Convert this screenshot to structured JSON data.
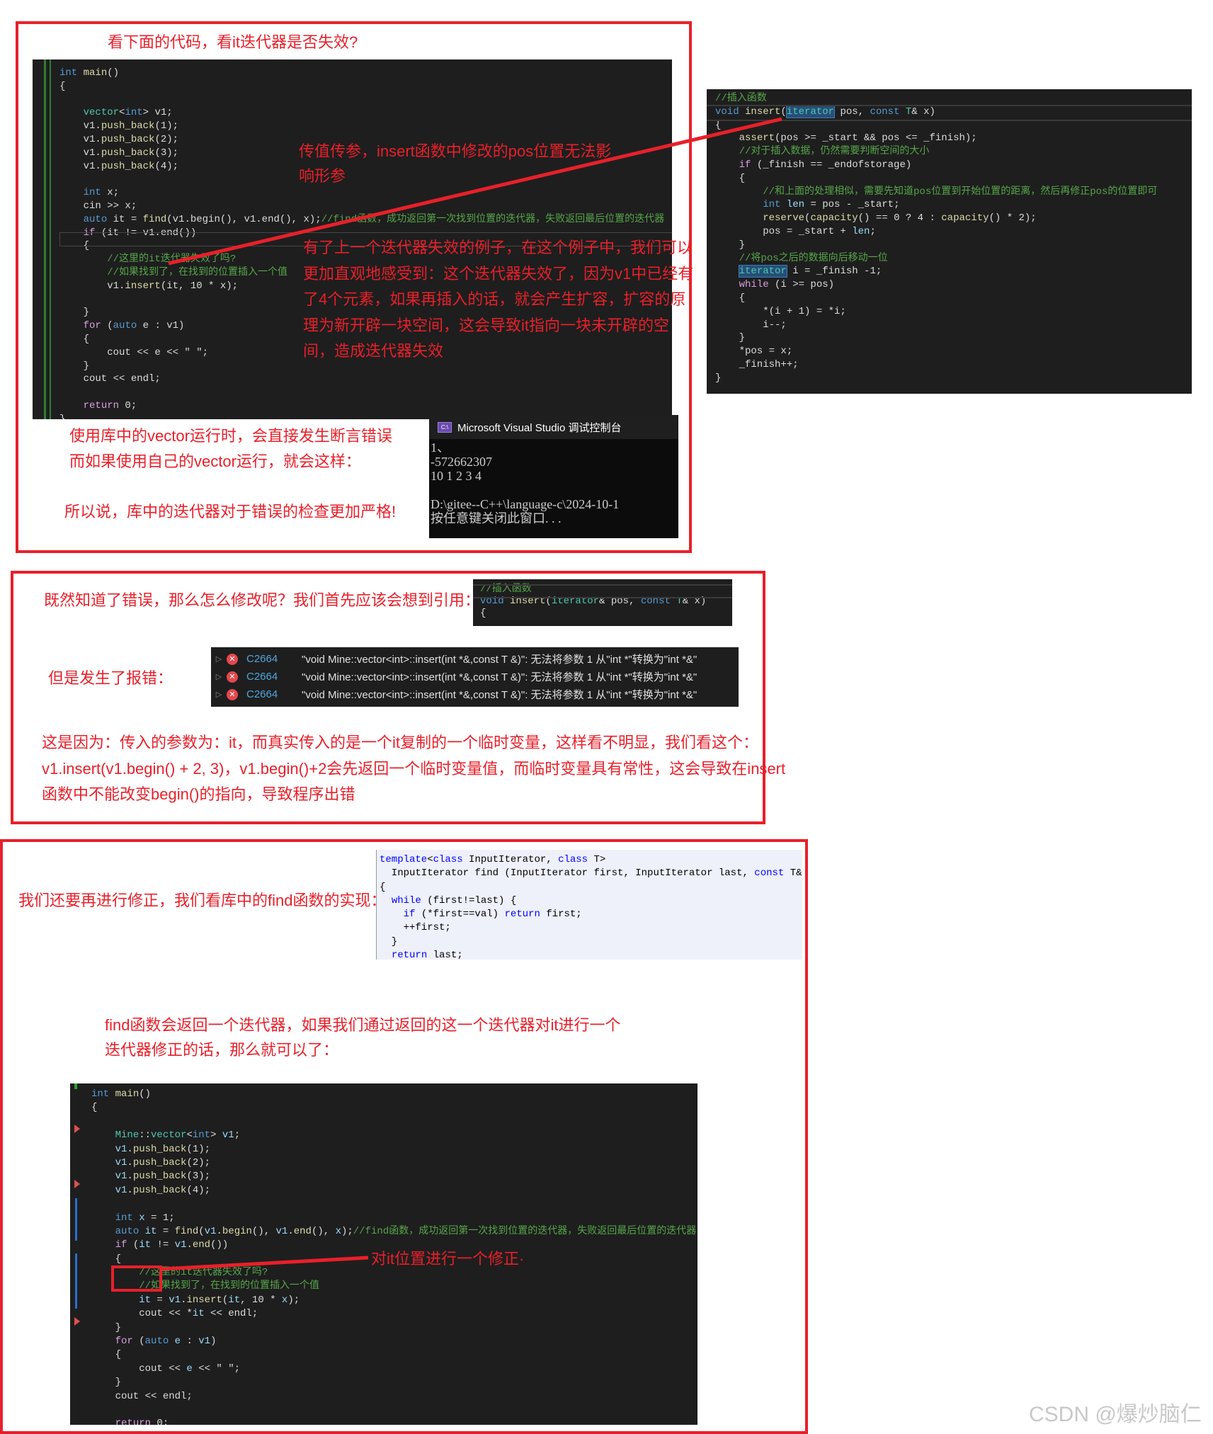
{
  "section1": {
    "title": "看下面的代码，看it迭代器是否失效?",
    "annotation_a": [
      "传值传参，insert函数中修改的pos位置无法影",
      "响形参"
    ],
    "annotation_b": [
      "有了上一个迭代器失效的例子，在这个例子中，我们可以",
      "更加直观地感受到：这个迭代器失效了，因为v1中已经有",
      "了4个元素，如果再插入的话，就会产生扩容，扩容的原",
      "理为新开辟一块空间，这会导致it指向一块未开辟的空",
      "间，造成迭代器失效"
    ],
    "notes": [
      "使用库中的vector运行时，会直接发生断言错误",
      "而如果使用自己的vector运行，就会这样：",
      "所以说，库中的迭代器对于错误的检查更加严格!"
    ],
    "console": {
      "icon_label": "C:\\",
      "title": "Microsoft Visual Studio 调试控制台",
      "output": [
        "1、",
        "-572662307",
        "10 1 2 3 4",
        "",
        "D:\\gitee--C++\\language-c\\2024-10-1",
        "按任意键关闭此窗口. . ."
      ]
    },
    "code_main": [
      [
        [
          "k",
          "int"
        ],
        [
          "f",
          " main"
        ],
        [
          "p",
          "()"
        ]
      ],
      [
        [
          "p",
          "{"
        ]
      ],
      [],
      [
        [
          "p",
          "    "
        ],
        [
          "t",
          "vector"
        ],
        [
          "p",
          "<"
        ],
        [
          "k",
          "int"
        ],
        [
          "p",
          "> v1;"
        ]
      ],
      [
        [
          "p",
          "    v1."
        ],
        [
          "f",
          "push_back"
        ],
        [
          "p",
          "(1);"
        ]
      ],
      [
        [
          "p",
          "    v1."
        ],
        [
          "f",
          "push_back"
        ],
        [
          "p",
          "(2);"
        ]
      ],
      [
        [
          "p",
          "    v1."
        ],
        [
          "f",
          "push_back"
        ],
        [
          "p",
          "(3);"
        ]
      ],
      [
        [
          "p",
          "    v1."
        ],
        [
          "f",
          "push_back"
        ],
        [
          "p",
          "(4);"
        ]
      ],
      [],
      [
        [
          "p",
          "    "
        ],
        [
          "k",
          "int"
        ],
        [
          "p",
          " x;"
        ]
      ],
      [
        [
          "p",
          "    cin >> x;"
        ]
      ],
      [
        [
          "p",
          "    "
        ],
        [
          "k",
          "auto"
        ],
        [
          "p",
          " it = "
        ],
        [
          "f",
          "find"
        ],
        [
          "p",
          "(v1.begin(), v1.end(), x);"
        ],
        [
          "c",
          "//find函数，成功返回第一次找到位置的迭代器，失败返回最后位置的迭代器"
        ]
      ],
      [
        [
          "p",
          "    "
        ],
        [
          "m",
          "if"
        ],
        [
          "p",
          " (it != v1.end())"
        ]
      ],
      [
        [
          "p",
          "    {"
        ]
      ],
      [
        [
          "p",
          "        "
        ],
        [
          "c",
          "//这里的it迭代器失效了吗?"
        ]
      ],
      [
        [
          "p",
          "        "
        ],
        [
          "c",
          "//如果找到了，在找到的位置插入一个值"
        ]
      ],
      [
        [
          "p",
          "        v1."
        ],
        [
          "f",
          "insert"
        ],
        [
          "p",
          "(it, 10 * x);"
        ]
      ],
      [],
      [
        [
          "p",
          "    }"
        ]
      ],
      [
        [
          "p",
          "    "
        ],
        [
          "m",
          "for"
        ],
        [
          "p",
          " ("
        ],
        [
          "k",
          "auto"
        ],
        [
          "p",
          " e : v1)"
        ]
      ],
      [
        [
          "p",
          "    {"
        ]
      ],
      [
        [
          "p",
          "        cout << e << \" \";"
        ]
      ],
      [
        [
          "p",
          "    }"
        ]
      ],
      [
        [
          "p",
          "    cout << endl;"
        ]
      ],
      [],
      [
        [
          "p",
          "    "
        ],
        [
          "m",
          "return"
        ],
        [
          "p",
          " 0;"
        ]
      ],
      [
        [
          "p",
          "}"
        ]
      ]
    ],
    "code_insert": [
      [
        [
          "c",
          "//插入函数"
        ]
      ],
      [
        [
          "k",
          "void"
        ],
        [
          "f",
          " insert"
        ],
        [
          "p",
          "("
        ],
        [
          "t hl",
          "iterator"
        ],
        [
          "p",
          " pos, "
        ],
        [
          "k",
          "const"
        ],
        [
          "t",
          " T"
        ],
        [
          "p",
          "& x)"
        ]
      ],
      [
        [
          "p",
          "{"
        ]
      ],
      [
        [
          "p",
          "    "
        ],
        [
          "f",
          "assert"
        ],
        [
          "p",
          "(pos >= _start && pos <= _finish);"
        ]
      ],
      [
        [
          "p",
          "    "
        ],
        [
          "c",
          "//对于插入数据，仍然需要判断空间的大小"
        ]
      ],
      [
        [
          "p",
          "    "
        ],
        [
          "m",
          "if"
        ],
        [
          "p",
          " (_finish == _endofstorage)"
        ]
      ],
      [
        [
          "p",
          "    {"
        ]
      ],
      [
        [
          "p",
          "        "
        ],
        [
          "c",
          "//和上面的处理相似，需要先知道pos位置到开始位置的距离，然后再修正pos的位置即可"
        ]
      ],
      [
        [
          "p",
          "        "
        ],
        [
          "k",
          "int"
        ],
        [
          "v",
          " len"
        ],
        [
          "p",
          " = pos - _start;"
        ]
      ],
      [
        [
          "p",
          "        "
        ],
        [
          "f",
          "reserve"
        ],
        [
          "p",
          "("
        ],
        [
          "f",
          "capacity"
        ],
        [
          "p",
          "() == 0 ? 4 : "
        ],
        [
          "f",
          "capacity"
        ],
        [
          "p",
          "() * 2);"
        ]
      ],
      [
        [
          "p",
          "        pos = _start + "
        ],
        [
          "v",
          "len"
        ],
        [
          "p",
          ";"
        ]
      ],
      [
        [
          "p",
          "    }"
        ]
      ],
      [
        [
          "p",
          "    "
        ],
        [
          "c",
          "//将pos之后的数据向后移动一位"
        ]
      ],
      [
        [
          "p",
          "    "
        ],
        [
          "t hl",
          "iterator"
        ],
        [
          "p",
          " i = _finish -1;"
        ]
      ],
      [
        [
          "p",
          "    "
        ],
        [
          "m",
          "while"
        ],
        [
          "p",
          " (i >= pos)"
        ]
      ],
      [
        [
          "p",
          "    {"
        ]
      ],
      [
        [
          "p",
          "        *(i + 1) = *i;"
        ]
      ],
      [
        [
          "p",
          "        i--;"
        ]
      ],
      [
        [
          "p",
          "    }"
        ]
      ],
      [
        [
          "p",
          "    *pos = x;"
        ]
      ],
      [
        [
          "p",
          "    _finish++;"
        ]
      ],
      [
        [
          "p",
          "}"
        ]
      ]
    ]
  },
  "section2": {
    "title": "既然知道了错误，那么怎么修改呢？我们首先应该会想到引用：",
    "code_ref": [
      [
        [
          "c",
          "//插入函数"
        ]
      ],
      [
        [
          "k",
          "void"
        ],
        [
          "f",
          " insert"
        ],
        [
          "p",
          "("
        ],
        [
          "t",
          "iterator"
        ],
        [
          "p",
          "& pos, "
        ],
        [
          "k",
          "const"
        ],
        [
          "t",
          " T"
        ],
        [
          "p",
          "& x)"
        ]
      ],
      [
        [
          "p",
          "{"
        ]
      ]
    ],
    "error_label": "但是发生了报错：",
    "errors": [
      {
        "code": "C2664",
        "message": "\"void Mine::vector<int>::insert(int *&,const T &)\": 无法将参数 1 从\"int *\"转换为\"int *&\""
      },
      {
        "code": "C2664",
        "message": "\"void Mine::vector<int>::insert(int *&,const T &)\": 无法将参数 1 从\"int *\"转换为\"int *&\""
      },
      {
        "code": "C2664",
        "message": "\"void Mine::vector<int>::insert(int *&,const T &)\": 无法将参数 1 从\"int *\"转换为\"int *&\""
      }
    ],
    "explanation": [
      "这是因为：传入的参数为：it，而真实传入的是一个it复制的一个临时变量，这样看不明显，我们看这个：",
      "v1.insert(v1.begin() + 2, 3)，v1.begin()+2会先返回一个临时变量值，而临时变量具有常性，这会导致在insert",
      "函数中不能改变begin()的指向，导致程序出错"
    ]
  },
  "section3": {
    "title": "我们还要再进行修正，我们看库中的find函数的实现：",
    "find_code": [
      [
        [
          "k",
          "template"
        ],
        [
          "p",
          "<"
        ],
        [
          "k",
          "class"
        ],
        [
          "p",
          " InputIterator, "
        ],
        [
          "k",
          "class"
        ],
        [
          "p",
          " T>"
        ]
      ],
      [
        [
          "p",
          "  InputIterator find (InputIterator first, InputIterator last, "
        ],
        [
          "k",
          "const"
        ],
        [
          "p",
          " T& val"
        ]
      ],
      [
        [
          "p",
          "{"
        ]
      ],
      [
        [
          "p",
          "  "
        ],
        [
          "k",
          "while"
        ],
        [
          "p",
          " (first!=last) {"
        ]
      ],
      [
        [
          "p",
          "    "
        ],
        [
          "k",
          "if"
        ],
        [
          "p",
          " (*first==val) "
        ],
        [
          "k",
          "return"
        ],
        [
          "p",
          " first;"
        ]
      ],
      [
        [
          "p",
          "    ++first;"
        ]
      ],
      [
        [
          "p",
          "  }"
        ]
      ],
      [
        [
          "p",
          "  "
        ],
        [
          "k",
          "return"
        ],
        [
          "p",
          " last;"
        ]
      ],
      [
        [
          "p",
          "}"
        ]
      ]
    ],
    "explanation": [
      "find函数会返回一个迭代器，如果我们通过返回的这一个迭代器对it进行一个",
      "迭代器修正的话，那么就可以了："
    ],
    "annotation": "对it位置进行一个修正·",
    "code_fixed": [
      [
        [
          "k",
          "int"
        ],
        [
          "f",
          " main"
        ],
        [
          "p",
          "()"
        ]
      ],
      [
        [
          "p",
          "{"
        ]
      ],
      [],
      [
        [
          "p",
          "    "
        ],
        [
          "t",
          "Mine"
        ],
        [
          "p",
          "::"
        ],
        [
          "t",
          "vector"
        ],
        [
          "p",
          "<"
        ],
        [
          "k",
          "int"
        ],
        [
          "p",
          "> "
        ],
        [
          "v",
          "v1"
        ],
        [
          "p",
          ";"
        ]
      ],
      [
        [
          "p",
          "    "
        ],
        [
          "v",
          "v1"
        ],
        [
          "p",
          "."
        ],
        [
          "f",
          "push_back"
        ],
        [
          "p",
          "(1);"
        ]
      ],
      [
        [
          "p",
          "    "
        ],
        [
          "v",
          "v1"
        ],
        [
          "p",
          "."
        ],
        [
          "f",
          "push_back"
        ],
        [
          "p",
          "(2);"
        ]
      ],
      [
        [
          "p",
          "    "
        ],
        [
          "v",
          "v1"
        ],
        [
          "p",
          "."
        ],
        [
          "f",
          "push_back"
        ],
        [
          "p",
          "(3);"
        ]
      ],
      [
        [
          "p",
          "    "
        ],
        [
          "v",
          "v1"
        ],
        [
          "p",
          "."
        ],
        [
          "f",
          "push_back"
        ],
        [
          "p",
          "(4);"
        ]
      ],
      [],
      [
        [
          "p",
          "    "
        ],
        [
          "k",
          "int"
        ],
        [
          "v",
          " x"
        ],
        [
          "p",
          " = 1;"
        ]
      ],
      [
        [
          "p",
          "    "
        ],
        [
          "k",
          "auto"
        ],
        [
          "v",
          " it"
        ],
        [
          "p",
          " = "
        ],
        [
          "f",
          "find"
        ],
        [
          "p",
          "("
        ],
        [
          "v",
          "v1"
        ],
        [
          "p",
          "."
        ],
        [
          "f",
          "begin"
        ],
        [
          "p",
          "(), "
        ],
        [
          "v",
          "v1"
        ],
        [
          "p",
          "."
        ],
        [
          "f",
          "end"
        ],
        [
          "p",
          "(), "
        ],
        [
          "v",
          "x"
        ],
        [
          "p",
          ");"
        ],
        [
          "c",
          "//find函数，成功返回第一次找到位置的迭代器，失败返回最后位置的迭代器"
        ]
      ],
      [
        [
          "p",
          "    "
        ],
        [
          "m",
          "if"
        ],
        [
          "p",
          " ("
        ],
        [
          "v",
          "it"
        ],
        [
          "p",
          " != "
        ],
        [
          "v",
          "v1"
        ],
        [
          "p",
          "."
        ],
        [
          "f",
          "end"
        ],
        [
          "p",
          "())"
        ]
      ],
      [
        [
          "p",
          "    {"
        ]
      ],
      [
        [
          "p",
          "        "
        ],
        [
          "c",
          "//这里的it迭代器失效了吗?"
        ]
      ],
      [
        [
          "p",
          "        "
        ],
        [
          "c",
          "//如果找到了，在找到的位置插入一个值"
        ]
      ],
      [
        [
          "p",
          "        "
        ],
        [
          "v",
          "it"
        ],
        [
          "p",
          " = "
        ],
        [
          "v",
          "v1"
        ],
        [
          "p",
          "."
        ],
        [
          "f",
          "insert"
        ],
        [
          "p",
          "("
        ],
        [
          "v",
          "it"
        ],
        [
          "p",
          ", 10 * "
        ],
        [
          "v",
          "x"
        ],
        [
          "p",
          ");"
        ]
      ],
      [
        [
          "p",
          "        cout << *"
        ],
        [
          "v",
          "it"
        ],
        [
          "p",
          " << endl;"
        ]
      ],
      [
        [
          "p",
          "    }"
        ]
      ],
      [
        [
          "p",
          "    "
        ],
        [
          "m",
          "for"
        ],
        [
          "p",
          " ("
        ],
        [
          "k",
          "auto"
        ],
        [
          "v",
          " e"
        ],
        [
          "p",
          " : "
        ],
        [
          "v",
          "v1"
        ],
        [
          "p",
          ")"
        ]
      ],
      [
        [
          "p",
          "    {"
        ]
      ],
      [
        [
          "p",
          "        cout << "
        ],
        [
          "v",
          "e"
        ],
        [
          "p",
          " << \" \";"
        ]
      ],
      [
        [
          "p",
          "    }"
        ]
      ],
      [
        [
          "p",
          "    cout << endl;"
        ]
      ],
      [],
      [
        [
          "p",
          "    "
        ],
        [
          "m",
          "return"
        ],
        [
          "p",
          " 0;"
        ]
      ],
      [
        [
          "p",
          "}"
        ]
      ]
    ]
  },
  "watermark": "CSDN @爆炒脑仁",
  "colors": {
    "annotation_red": "#e8202a",
    "editor_bg": "#1e1e1e",
    "error_red": "#e5484d"
  }
}
